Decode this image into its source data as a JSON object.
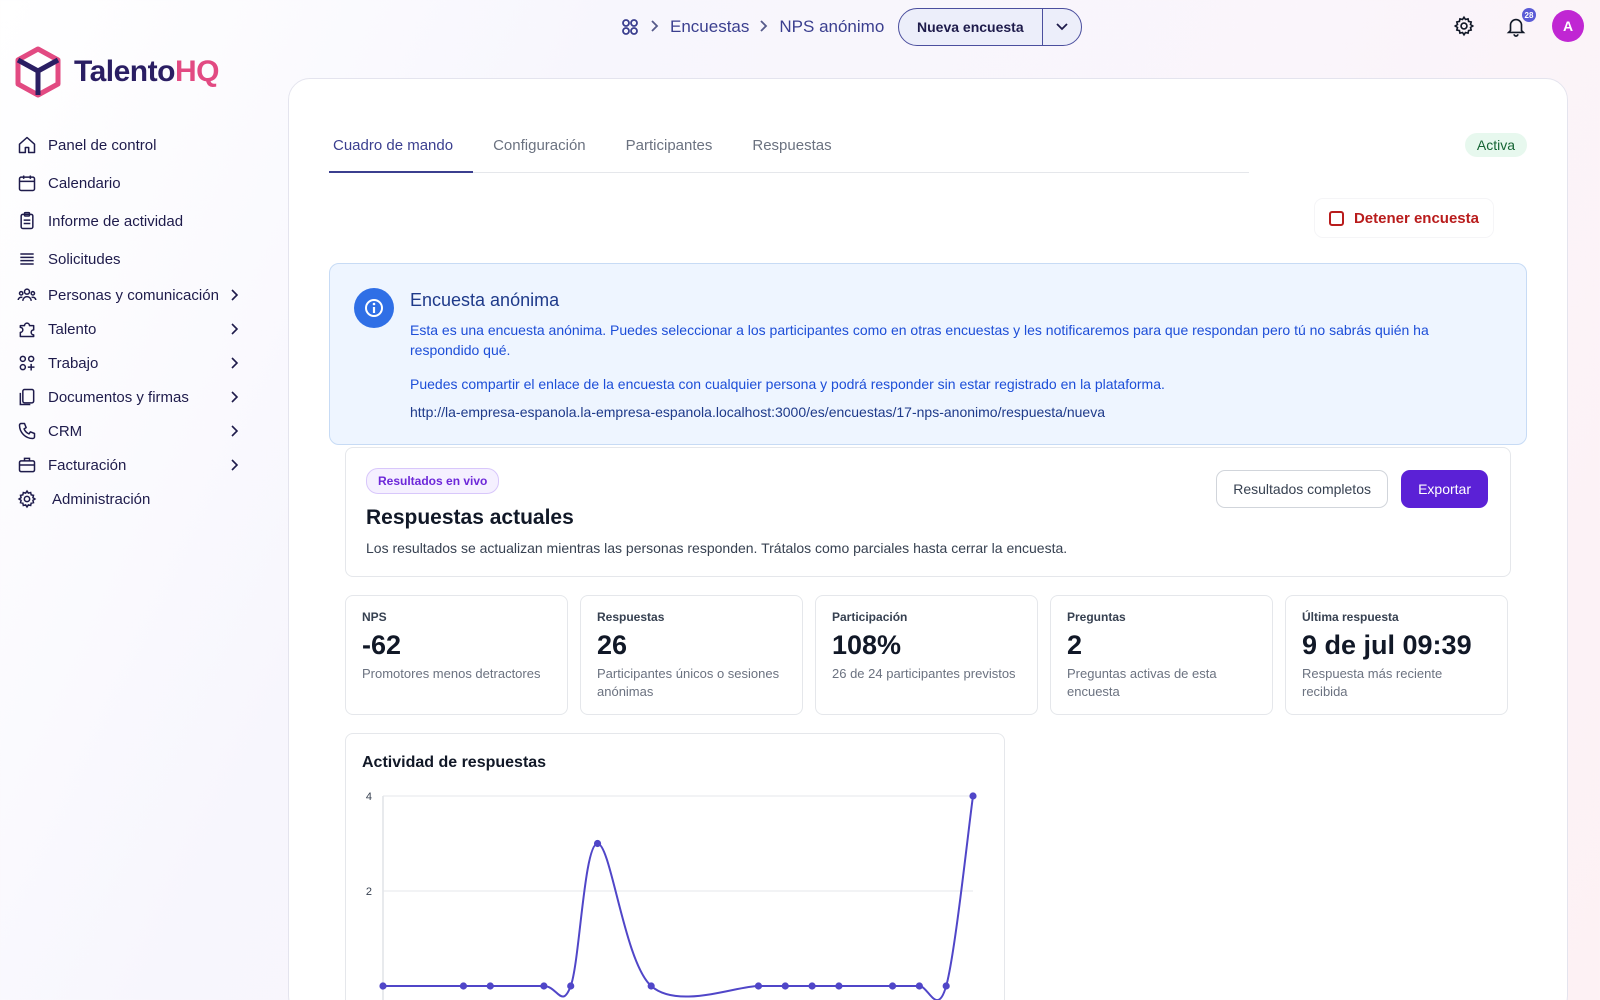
{
  "header": {
    "breadcrumb": [
      "Encuestas",
      "NPS anónimo"
    ],
    "new_survey_label": "Nueva encuesta",
    "notification_count": "28",
    "avatar_initial": "A"
  },
  "brand": {
    "name_part1": "Talento",
    "name_part2": "HQ"
  },
  "sidebar": {
    "items": [
      {
        "label": "Panel de control",
        "icon": "home-icon",
        "has_children": false
      },
      {
        "label": "Calendario",
        "icon": "calendar-icon",
        "has_children": false
      },
      {
        "label": "Informe de actividad",
        "icon": "clipboard-icon",
        "has_children": false
      },
      {
        "label": "Solicitudes",
        "icon": "list-icon",
        "has_children": false
      },
      {
        "label": "Personas y comunicación",
        "icon": "users-icon",
        "has_children": true
      },
      {
        "label": "Talento",
        "icon": "puzzle-icon",
        "has_children": true
      },
      {
        "label": "Trabajo",
        "icon": "grid-icon",
        "has_children": true
      },
      {
        "label": "Documentos y firmas",
        "icon": "documents-icon",
        "has_children": true
      },
      {
        "label": "CRM",
        "icon": "phone-icon",
        "has_children": true
      },
      {
        "label": "Facturación",
        "icon": "briefcase-icon",
        "has_children": true
      },
      {
        "label": "Administración",
        "icon": "gear-icon",
        "has_children": false
      }
    ]
  },
  "tabs": [
    {
      "label": "Cuadro de mando",
      "active": true
    },
    {
      "label": "Configuración",
      "active": false
    },
    {
      "label": "Participantes",
      "active": false
    },
    {
      "label": "Respuestas",
      "active": false
    }
  ],
  "status": {
    "label": "Activa",
    "color": "#166534"
  },
  "stop_button": {
    "label": "Detener encuesta"
  },
  "info": {
    "title": "Encuesta anónima",
    "paragraph1": "Esta es una encuesta anónima. Puedes seleccionar a los participantes como en otras encuestas y les notificaremos para que respondan pero tú no sabrás quién ha respondido qué.",
    "paragraph2": "Puedes compartir el enlace de la encuesta con cualquier persona y podrá responder sin estar registrado en la plataforma.",
    "link": "http://la-empresa-espanola.la-empresa-espanola.localhost:3000/es/encuestas/17-nps-anonimo/respuesta/nueva"
  },
  "live": {
    "pill": "Resultados en vivo",
    "title": "Respuestas actuales",
    "description": "Los resultados se actualizan mientras las personas responden. Trátalos como parciales hasta cerrar la encuesta.",
    "full_results_label": "Resultados completos",
    "export_label": "Exportar"
  },
  "stats": [
    {
      "label": "NPS",
      "value": "-62",
      "sub": "Promotores menos detractores"
    },
    {
      "label": "Respuestas",
      "value": "26",
      "sub": "Participantes únicos o sesiones anónimas"
    },
    {
      "label": "Participación",
      "value": "108%",
      "sub": "26 de 24 participantes previstos"
    },
    {
      "label": "Preguntas",
      "value": "2",
      "sub": "Preguntas activas de esta encuesta"
    },
    {
      "label": "Última respuesta",
      "value": "9 de jul 09:39",
      "sub": "Respuesta más reciente recibida"
    }
  ],
  "chart_data": {
    "type": "line",
    "title": "Actividad de respuestas",
    "ylim": [
      0,
      4
    ],
    "yticks": [
      "4",
      "2"
    ],
    "grid": true,
    "series": [
      {
        "values": [
          0,
          0,
          0,
          0,
          0,
          3,
          0,
          0,
          0,
          0,
          0,
          0,
          0,
          0,
          4
        ],
        "x": [
          0,
          3,
          4,
          6,
          7,
          8,
          10,
          14,
          15,
          16,
          17,
          19,
          20,
          21,
          22
        ]
      }
    ],
    "xmax": 22,
    "line_color": "#5046c8"
  },
  "colors": {
    "accent": "#5b21d6",
    "nav_text": "#1e1b4b",
    "danger": "#b91c1c",
    "info_blue": "#2f6fe6"
  }
}
